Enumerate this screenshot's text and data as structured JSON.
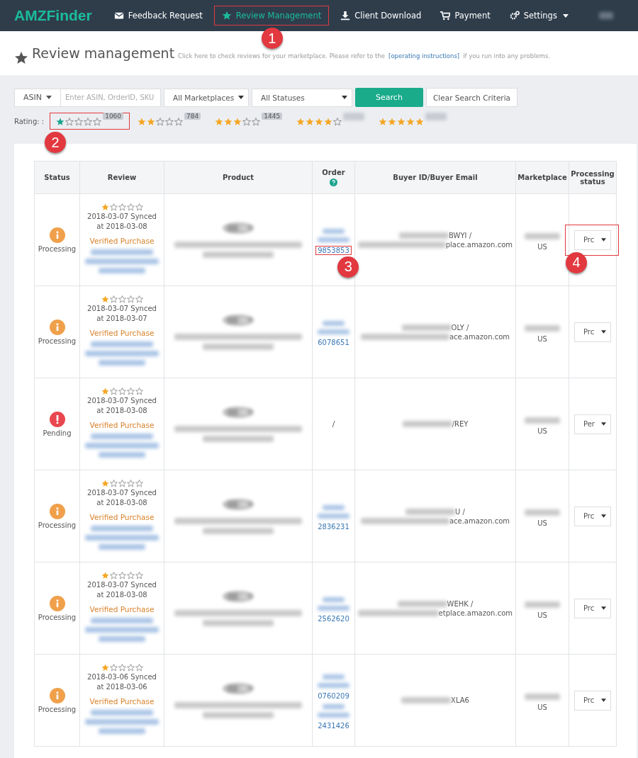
{
  "navbar": {
    "logo": "AMZFinder",
    "items": [
      {
        "label": "Feedback Request",
        "selected": false
      },
      {
        "label": "Review Management",
        "selected": true
      },
      {
        "label": "Client Download",
        "selected": false
      },
      {
        "label": "Payment",
        "selected": false
      },
      {
        "label": "Settings",
        "selected": false,
        "dropdown": true
      }
    ]
  },
  "header": {
    "title": "Review management",
    "hint": "Click here to check reviews for your marketplace. Please refer to the",
    "link": "[operating instructions]",
    "hint_end": "if you run into any problems."
  },
  "filters": {
    "search_type": "ASIN",
    "placeholder": "Enter ASIN, OrderID, SKU",
    "marketplace": "All Marketplaces",
    "status": "All Statuses",
    "search_button": "Search",
    "clear_button": "Clear Search Criteria"
  },
  "rating": {
    "label": "Rating: :",
    "options": [
      {
        "stars": 1,
        "count": "1060",
        "selected": true
      },
      {
        "stars": 2,
        "count": "784",
        "selected": false
      },
      {
        "stars": 3,
        "count": "1445",
        "selected": false
      },
      {
        "stars": 4,
        "selected": false
      },
      {
        "stars": 5,
        "selected": false
      }
    ]
  },
  "table": {
    "columns": [
      "Status",
      "Review",
      "Product",
      "Order",
      "Buyer ID/Buyer Email",
      "Marketplace",
      "Processing status"
    ],
    "rows": [
      {
        "status": {
          "kind": "processing",
          "label": "Processing"
        },
        "stars": 1,
        "date": "2018-03-07 Synced at 2018-03-08",
        "verified": "Verified Purchase",
        "orders": [
          "9853853"
        ],
        "buyer": [
          "BWYI /",
          "place.amazon.com"
        ],
        "marketplace": "US",
        "processing": "Prc"
      },
      {
        "status": {
          "kind": "processing",
          "label": "Processing"
        },
        "stars": 1,
        "date": "2018-03-07 Synced at 2018-03-07",
        "verified": "Verified Purchase",
        "orders": [
          "6078651"
        ],
        "buyer": [
          "OLY /",
          "ace.amazon.com"
        ],
        "marketplace": "US",
        "processing": "Prc"
      },
      {
        "status": {
          "kind": "pending",
          "label": "Pending"
        },
        "stars": 1,
        "date": "2018-03-07 Synced at 2018-03-08",
        "verified": "Verified Purchase",
        "order_none": "/",
        "buyer": [
          "/REY"
        ],
        "marketplace": "US",
        "processing": "Per"
      },
      {
        "status": {
          "kind": "processing",
          "label": "Processing"
        },
        "stars": 1,
        "date": "2018-03-07 Synced at 2018-03-08",
        "verified": "Verified Purchase",
        "orders": [
          "2836231"
        ],
        "buyer": [
          "U /",
          "ace.amazon.com"
        ],
        "marketplace": "US",
        "processing": "Prc"
      },
      {
        "status": {
          "kind": "processing",
          "label": "Processing"
        },
        "stars": 1,
        "date": "2018-03-07 Synced at 2018-03-08",
        "verified": "Verified Purchase",
        "orders": [
          "2562620"
        ],
        "buyer": [
          "WEHK /",
          "etplace.amazon.com"
        ],
        "marketplace": "US",
        "processing": "Prc"
      },
      {
        "status": {
          "kind": "processing",
          "label": "Processing"
        },
        "stars": 1,
        "date": "2018-03-06 Synced at 2018-03-06",
        "verified": "Verified Purchase",
        "orders": [
          "0760209",
          "2431426"
        ],
        "buyer": [
          "XLA6"
        ],
        "marketplace": "US",
        "processing": "Prc"
      }
    ]
  },
  "annotations": [
    "1",
    "2",
    "3",
    "4"
  ]
}
